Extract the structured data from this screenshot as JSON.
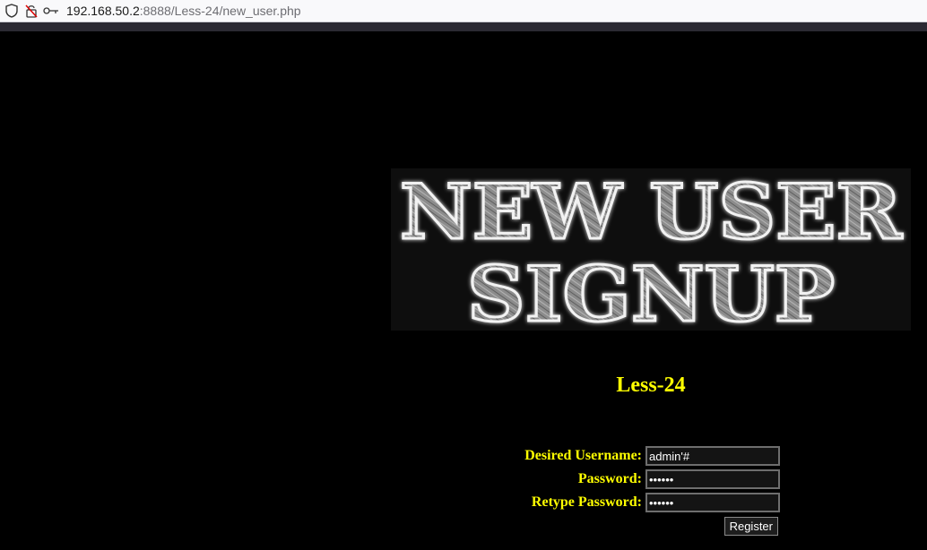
{
  "browser": {
    "url_host": "192.168.50.2",
    "url_rest": ":8888/Less-24/new_user.php"
  },
  "banner": {
    "line1": "NEW USER",
    "line2": "SIGNUP"
  },
  "page": {
    "title": "Less-24"
  },
  "form": {
    "username_label": "Desired Username:",
    "username_value": "admin'#",
    "password_label": "Password:",
    "password_value": "••••••",
    "retype_label": "Retype Password:",
    "retype_value": "••••••",
    "register_label": "Register"
  },
  "colors": {
    "background": "#000000",
    "label": "#ffff00"
  }
}
